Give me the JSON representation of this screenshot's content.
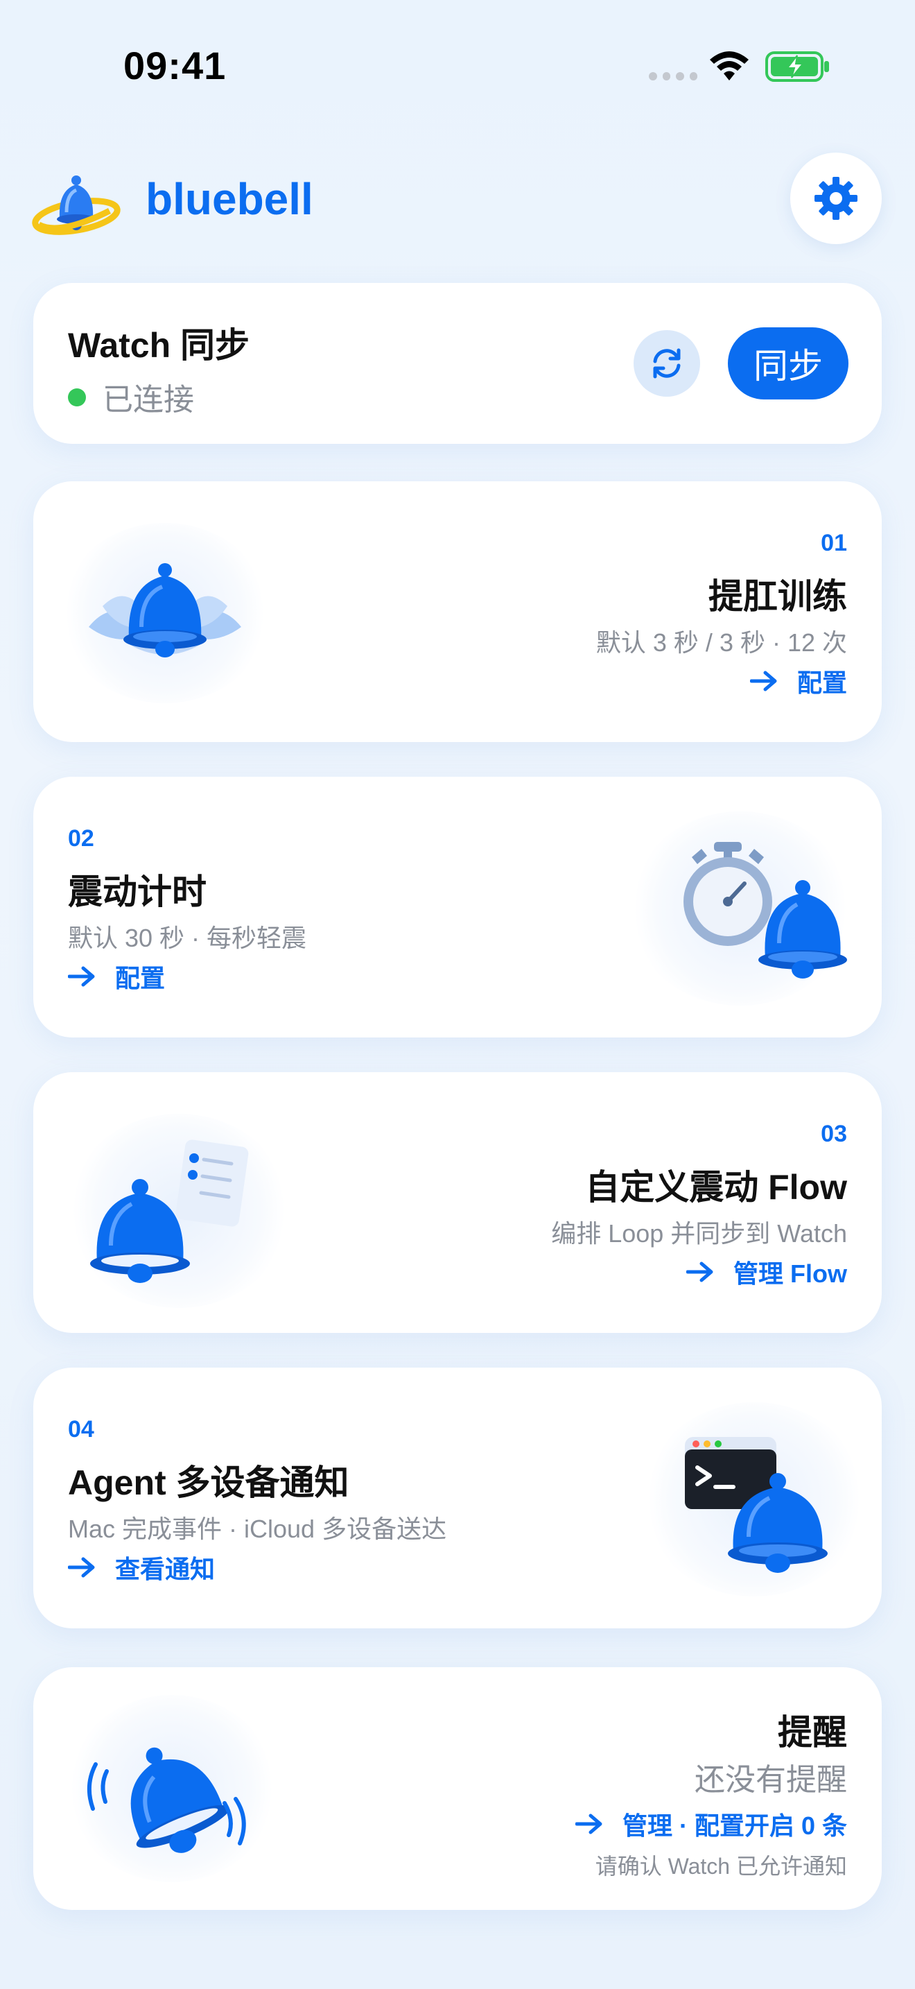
{
  "status_bar": {
    "time": "09:41"
  },
  "header": {
    "app_name": "bluebell"
  },
  "sync_card": {
    "title": "Watch 同步",
    "status": "已连接",
    "sync_label": "同步"
  },
  "features": [
    {
      "number": "01",
      "title": "提肛训练",
      "subtitle": "默认 3 秒 / 3 秒 · 12 次",
      "link": "配置"
    },
    {
      "number": "02",
      "title": "震动计时",
      "subtitle": "默认 30 秒 · 每秒轻震",
      "link": "配置"
    },
    {
      "number": "03",
      "title": "自定义震动 Flow",
      "subtitle": "编排 Loop 并同步到 Watch",
      "link": "管理 Flow"
    },
    {
      "number": "04",
      "title": "Agent 多设备通知",
      "subtitle": "Mac 完成事件 · iCloud 多设备送达",
      "link": "查看通知"
    }
  ],
  "reminders": {
    "title": "提醒",
    "empty_text": "还没有提醒",
    "link": "管理 · 配置开启 0 条",
    "note": "请确认 Watch 已允许通知"
  },
  "colors": {
    "accent": "#0b6df0",
    "connected": "#34c759",
    "battery": "#34c759"
  }
}
